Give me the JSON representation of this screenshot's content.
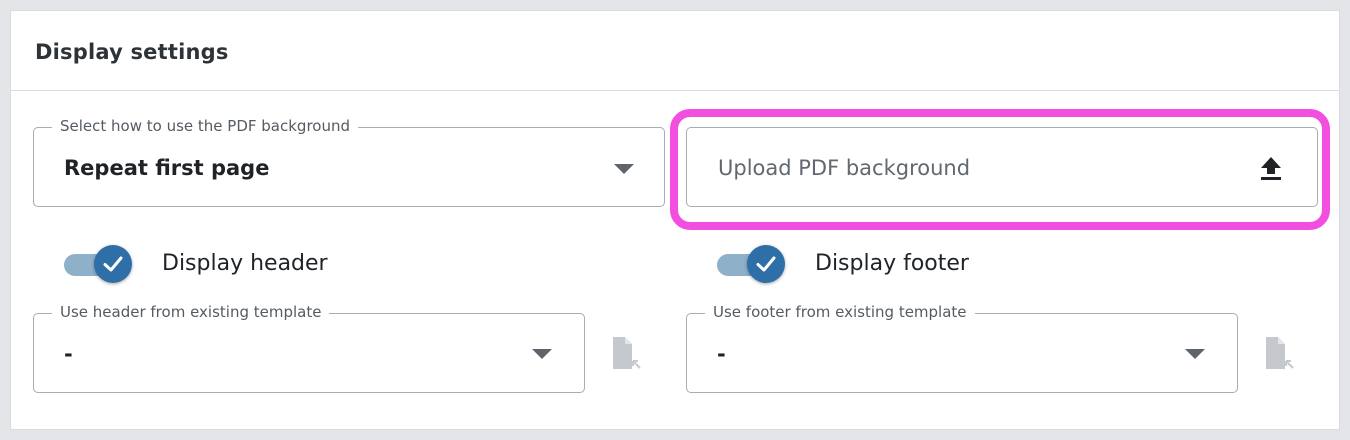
{
  "card": {
    "title": "Display settings"
  },
  "pdf_background_select": {
    "legend": "Select how to use the PDF background",
    "value": "Repeat first page"
  },
  "upload_pdf": {
    "placeholder": "Upload PDF background",
    "icon": "upload-icon",
    "highlight_color": "#f24ee0"
  },
  "display_header": {
    "label": "Display header",
    "checked": true
  },
  "display_footer": {
    "label": "Display footer",
    "checked": true
  },
  "header_template_select": {
    "legend": "Use header from existing template",
    "value": "-"
  },
  "footer_template_select": {
    "legend": "Use footer from existing template",
    "value": "-"
  },
  "colors": {
    "accent": "#2f6fa7",
    "toggle_track": "#8fb0c9",
    "icon_disabled": "#c5c9cd"
  }
}
